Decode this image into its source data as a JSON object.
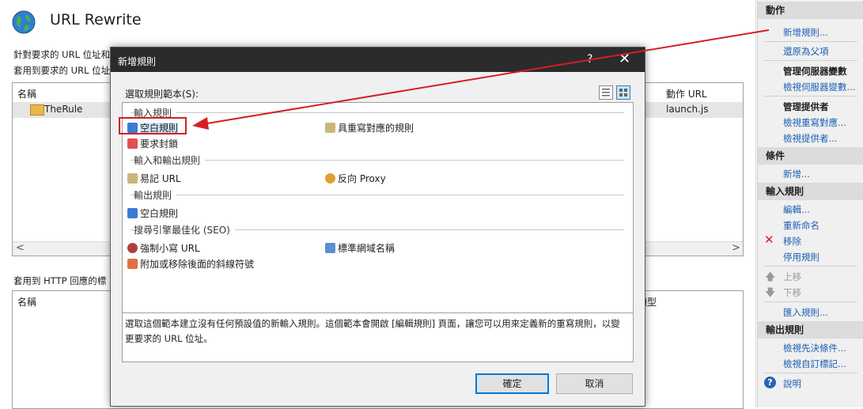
{
  "page": {
    "title": "URL Rewrite",
    "desc1": "針對要求的 URL 位址和",
    "desc2": "套用到要求的 URL 位址",
    "grid1": {
      "col_name": "名稱",
      "col_action": "動作 URL",
      "row_name": "TheRule",
      "row_action": "launch.js"
    },
    "http_label": "套用到 HTTP 回應的標",
    "grid2": {
      "col_name": "名稱",
      "col_type": "類型"
    }
  },
  "actions": {
    "header": "動作",
    "items": {
      "add_rule": "新增規則...",
      "revert": "還原為父項",
      "manage_server_vars": "管理伺服器變數",
      "view_server_vars": "檢視伺服器變數...",
      "manage_providers": "管理提供者",
      "view_rewrite_maps": "檢視重寫對應...",
      "view_providers": "檢視提供者..."
    },
    "conditions_header": "條件",
    "conditions_add": "新增...",
    "inbound_header": "輸入規則",
    "edit": "編輯...",
    "rename": "重新命名",
    "remove": "移除",
    "disable": "停用規則",
    "move_up": "上移",
    "move_down": "下移",
    "import": "匯入規則...",
    "outbound_header": "輸出規則",
    "view_preconditions": "檢視先決條件...",
    "view_custom_tags": "檢視自訂標記...",
    "help": "說明"
  },
  "dialog": {
    "title": "新增規則",
    "help_glyph": "?",
    "close_glyph": "✕",
    "template_label": "選取規則範本(S):",
    "groups": {
      "inbound": "輸入規則",
      "inout": "輸入和輸出規則",
      "outbound": "輸出規則",
      "seo": "搜尋引擎最佳化 (SEO)"
    },
    "items": {
      "blank_rule": "空白規則",
      "rule_with_map": "具重寫對應的規則",
      "request_blocking": "要求封鎖",
      "user_friendly_url": "易記 URL",
      "reverse_proxy": "反向 Proxy",
      "outbound_blank": "空白規則",
      "enforce_lowercase": "強制小寫 URL",
      "canonical_domain": "標準網域名稱",
      "trailing_slash": "附加或移除後面的斜線符號"
    },
    "description": "選取這個範本建立沒有任何預設值的新輸入規則。這個範本會開啟 [編輯規則] 頁面，讓您可以用來定義新的重寫規則，以變更要求的 URL 位址。",
    "ok": "確定",
    "cancel": "取消"
  },
  "colors": {
    "accent": "#0078d7",
    "highlight": "#d32020",
    "link": "#1a5fb4"
  }
}
